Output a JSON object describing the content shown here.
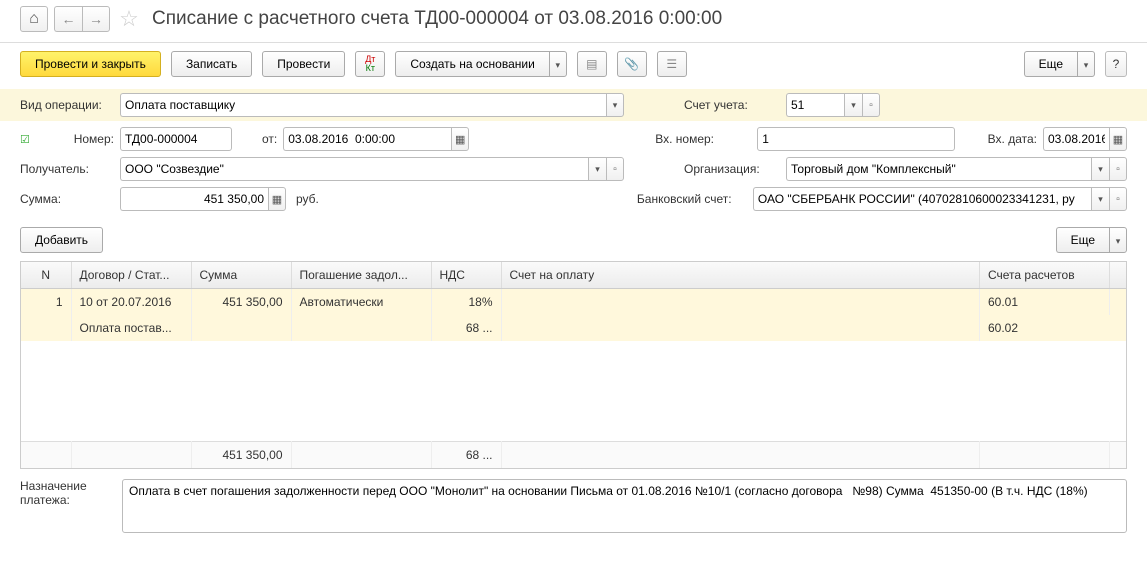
{
  "header": {
    "title": "Списание с расчетного счета ТД00-000004 от 03.08.2016 0:00:00"
  },
  "toolbar": {
    "post_close": "Провести и закрыть",
    "write": "Записать",
    "post": "Провести",
    "create_based": "Создать на основании",
    "more": "Еще",
    "help": "?"
  },
  "labels": {
    "op_type": "Вид операции:",
    "number": "Номер:",
    "from": "от:",
    "recipient": "Получатель:",
    "sum": "Сумма:",
    "rub": "руб.",
    "account": "Счет учета:",
    "in_number": "Вх. номер:",
    "in_date": "Вх. дата:",
    "org": "Организация:",
    "bank_acc": "Банковский счет:",
    "add": "Добавить",
    "purpose": "Назначение платежа:"
  },
  "fields": {
    "op_type": "Оплата поставщику",
    "number": "ТД00-000004",
    "date": "03.08.2016  0:00:00",
    "recipient": "ООО \"Созвездие\"",
    "sum": "451 350,00",
    "account": "51",
    "in_number": "1",
    "in_date": "03.08.2016",
    "org": "Торговый дом \"Комплексный\"",
    "bank_acc": "ОАО \"СБЕРБАНК РОССИИ\" (40702810600023341231, ру"
  },
  "table": {
    "cols": {
      "n": "N",
      "contract": "Договор / Стат...",
      "sum": "Сумма",
      "repay": "Погашение задол...",
      "vat": "НДС",
      "invoice": "Счет на оплату",
      "accounts": "Счета расчетов"
    },
    "row1": {
      "n": "1",
      "contract_l1": "10 от 20.07.2016",
      "contract_l2": "Оплата постав...",
      "sum": "451 350,00",
      "repay": "Автоматически",
      "vat_l1": "18%",
      "vat_l2": "68 ...",
      "acc_l1": "60.01",
      "acc_l2": "60.02"
    },
    "totals": {
      "sum": "451 350,00",
      "vat": "68 ..."
    }
  },
  "purpose_text": "Оплата в счет погашения задолженности перед ООО \"Монолит\" на основании Письма от 01.08.2016 №10/1 (согласно договора   №98) Сумма  451350-00 (В т.ч. НДС (18%)"
}
